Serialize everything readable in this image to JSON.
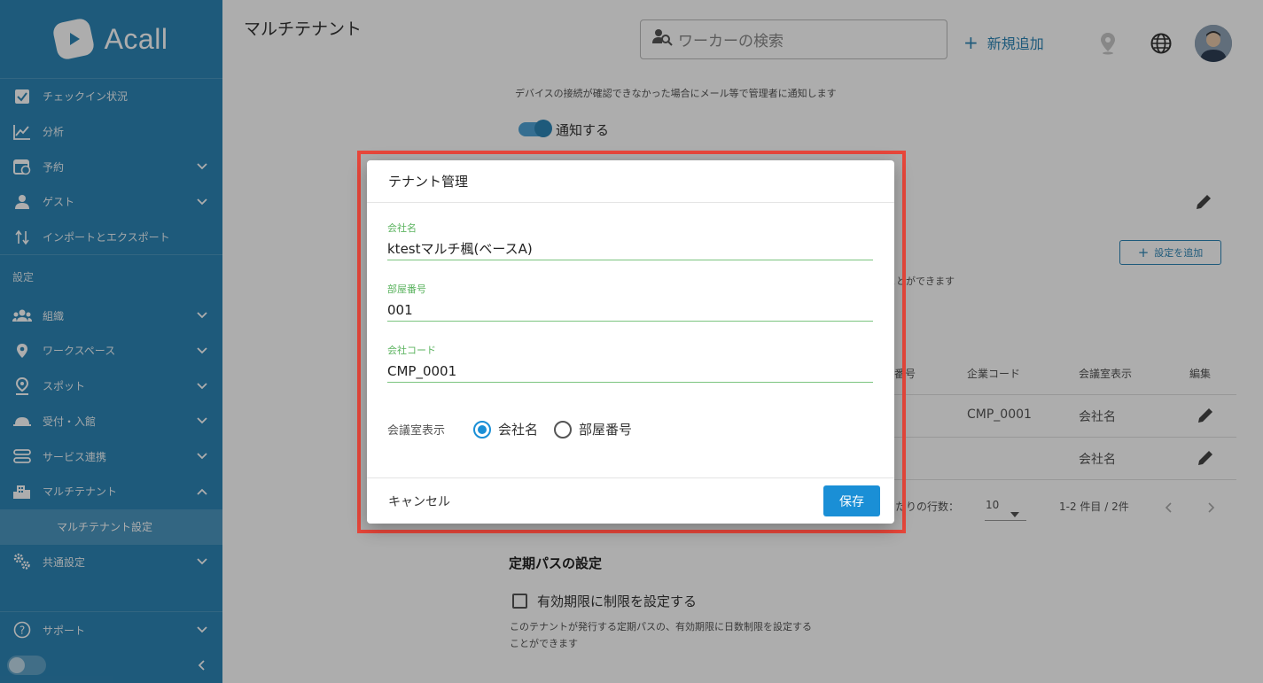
{
  "app": {
    "logo_text": "Acall"
  },
  "sidebar": {
    "items_top": [
      {
        "label": "チェックイン状況",
        "icon": "checkbox-icon",
        "chevron": ""
      },
      {
        "label": "分析",
        "icon": "chart-line-icon",
        "chevron": ""
      },
      {
        "label": "予約",
        "icon": "calendar-icon",
        "chevron": "down"
      },
      {
        "label": "ゲスト",
        "icon": "guest-icon",
        "chevron": "down"
      },
      {
        "label": "インポートとエクスポート",
        "icon": "import-export-icon",
        "chevron": ""
      }
    ],
    "settings_label": "設定",
    "items_settings": [
      {
        "label": "組織",
        "icon": "people-icon",
        "chevron": "down"
      },
      {
        "label": "ワークスペース",
        "icon": "location-pin-icon",
        "chevron": "down"
      },
      {
        "label": "スポット",
        "icon": "person-pin-icon",
        "chevron": "down"
      },
      {
        "label": "受付・入館",
        "icon": "bell-icon",
        "chevron": "down"
      },
      {
        "label": "サービス連携",
        "icon": "link-icon",
        "chevron": "down"
      },
      {
        "label": "マルチテナント",
        "icon": "building-icon",
        "chevron": "up"
      }
    ],
    "sub_item": "マルチテナント設定",
    "items_after": [
      {
        "label": "共通設定",
        "icon": "gears-icon",
        "chevron": "down"
      }
    ],
    "support": {
      "label": "サポート",
      "icon": "help-icon"
    }
  },
  "header": {
    "page_title": "マルチテナント",
    "search_placeholder": "ワーカーの検索",
    "add_new_label": "新規追加"
  },
  "background": {
    "device_note": "デバイスの接続が確認できなかった場合にメール等で管理者に通知します",
    "notify_label": "通知する",
    "add_setting_label": "設定を追加",
    "partial_note": "ことができます",
    "table_headers": [
      "番号",
      "企業コード",
      "会議室表示",
      "編集"
    ],
    "rows": [
      {
        "code": "CMP_0001",
        "display": "会社名"
      },
      {
        "code": "",
        "display": "会社名"
      }
    ],
    "rows_per_page_label": "たりの行数：",
    "rows_per_page_value": "10",
    "range_label": "1-2 件目 / 2件",
    "pass_section_title": "定期パスの設定",
    "pass_checkbox_label": "有効期限に制限を設定する",
    "pass_note_1": "このテナントが発行する定期パスの、有効期限に日数制限を設定する",
    "pass_note_2": "ことができます"
  },
  "modal": {
    "title": "テナント管理",
    "fields": [
      {
        "label": "会社名",
        "value": "ktestマルチ楓(ベースA)"
      },
      {
        "label": "部屋番号",
        "value": "001"
      },
      {
        "label": "会社コード",
        "value": "CMP_0001"
      }
    ],
    "display_label": "会議室表示",
    "radio_options": [
      "会社名",
      "部屋番号"
    ],
    "radio_selected": "会社名",
    "cancel_label": "キャンセル",
    "save_label": "保存"
  },
  "colors": {
    "sidebar": "#2d85b5",
    "accent": "#1a8fd6",
    "field_line": "#7bc47f",
    "highlight": "#e8473b"
  }
}
